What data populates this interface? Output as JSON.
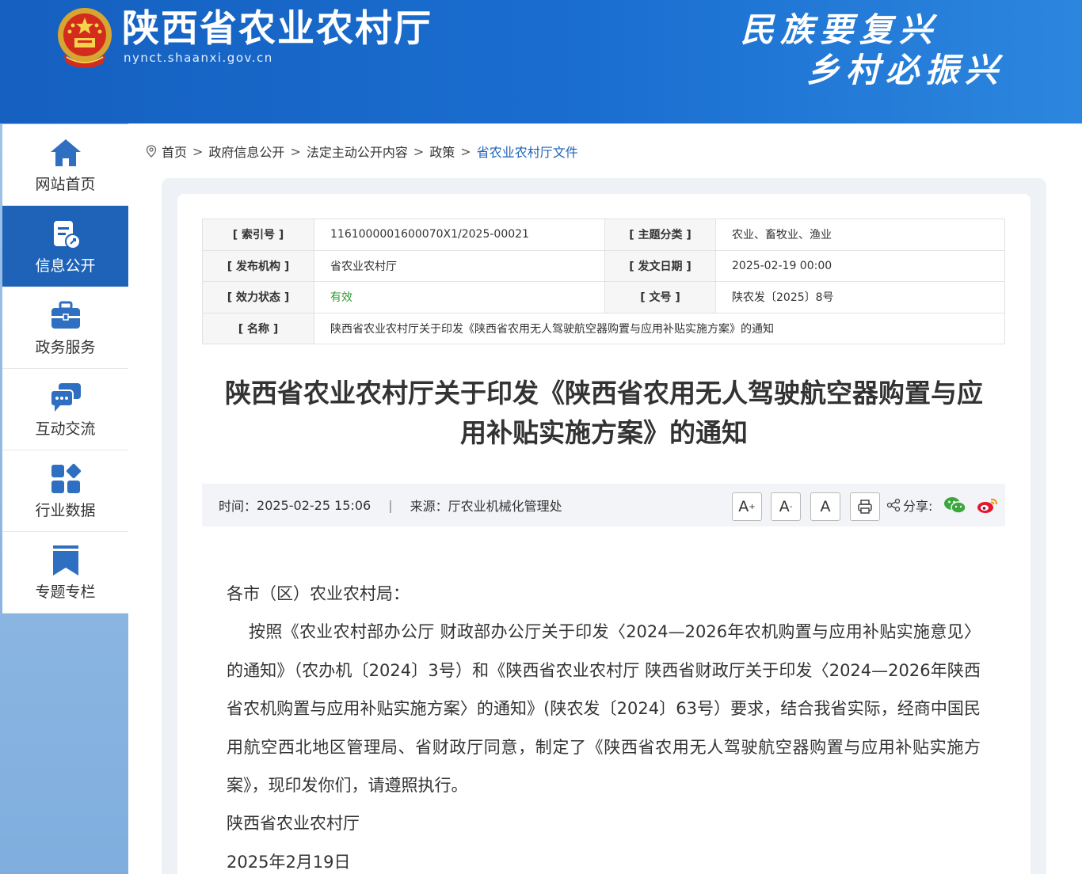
{
  "header": {
    "site_title": "陕西省农业农村厅",
    "site_domain": "nynct.shaanxi.gov.cn",
    "slogan_line1": "民族要复兴",
    "slogan_line2": "乡村必振兴"
  },
  "sidebar": {
    "items": [
      {
        "label": "网站首页",
        "icon": "home-icon"
      },
      {
        "label": "信息公开",
        "icon": "document-icon",
        "active": true
      },
      {
        "label": "政务服务",
        "icon": "briefcase-icon"
      },
      {
        "label": "互动交流",
        "icon": "chat-icon"
      },
      {
        "label": "行业数据",
        "icon": "data-grid-icon"
      },
      {
        "label": "专题专栏",
        "icon": "bookmark-icon"
      }
    ]
  },
  "breadcrumb": {
    "items": [
      "首页",
      "政府信息公开",
      "法定主动公开内容",
      "政策",
      "省农业农村厅文件"
    ],
    "separator": ">"
  },
  "info_table": {
    "index_label": "[ 索引号 ]",
    "index_value": "1161000001600070X1/2025-00021",
    "topic_label": "[ 主题分类 ]",
    "topic_value": "农业、畜牧业、渔业",
    "publisher_label": "[ 发布机构 ]",
    "publisher_value": "省农业农村厅",
    "date_label": "[ 发文日期 ]",
    "date_value": "2025-02-19 00:00",
    "status_label": "[ 效力状态 ]",
    "status_value": "有效",
    "docno_label": "[ 文号 ]",
    "docno_value": "陕农发〔2025〕8号",
    "name_label": "[ 名称 ]",
    "name_value": "陕西省农业农村厅关于印发《陕西省农用无人驾驶航空器购置与应用补贴实施方案》的通知"
  },
  "article": {
    "title": "陕西省农业农村厅关于印发《陕西省农用无人驾驶航空器购置与应用补贴实施方案》的通知",
    "greeting": "各市（区）农业农村局：",
    "paragraph": "按照《农业农村部办公厅 财政部办公厅关于印发〈2024—2026年农机购置与应用补贴实施意见〉的通知》（农办机〔2024〕3号）和《陕西省农业农村厅 陕西省财政厅关于印发〈2024—2026年陕西省农机购置与应用补贴实施方案〉的通知》(陕农发〔2024〕63号）要求，结合我省实际，经商中国民用航空西北地区管理局、省财政厅同意，制定了《陕西省农用无人驾驶航空器购置与应用补贴实施方案》，现印发你们，请遵照执行。",
    "signature": "陕西省农业农村厅",
    "sign_date": "2025年2月19日"
  },
  "meta": {
    "time_label": "时间：",
    "time_value": "2025-02-25 15:06",
    "divider": "|",
    "source_label": "来源：",
    "source_value": "厅农业机械化管理处",
    "font_large": "A",
    "font_small": "A",
    "font_normal": "A",
    "share_label": "分享:"
  },
  "colors": {
    "header_blue": "#1a6ed0",
    "active_nav": "#1e63b8",
    "valid_green": "#2e9b2e",
    "link_blue": "#1e63b8"
  }
}
